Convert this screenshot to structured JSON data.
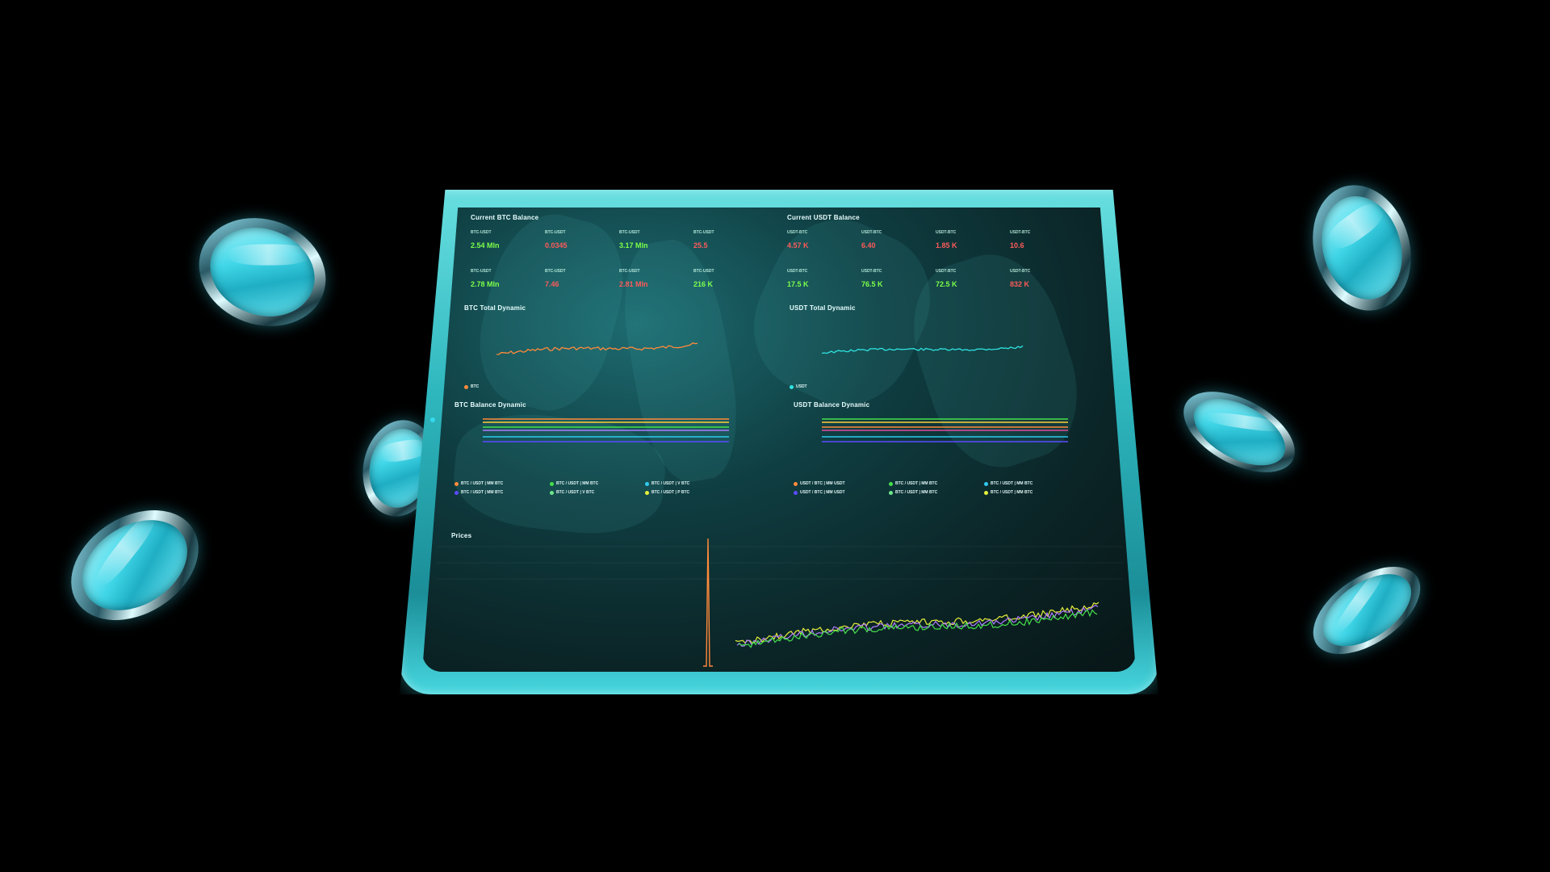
{
  "btc_balance": {
    "title": "Current BTC Balance",
    "cells": [
      {
        "label": "BTC-USDT",
        "value": "2.54 Mln",
        "tone": "pos"
      },
      {
        "label": "BTC-USDT",
        "value": "0.0345",
        "tone": "neg"
      },
      {
        "label": "BTC-USDT",
        "value": "3.17 Mln",
        "tone": "pos"
      },
      {
        "label": "BTC-USDT",
        "value": "25.5",
        "tone": "neg"
      },
      {
        "label": "BTC-USDT",
        "value": "2.78 Mln",
        "tone": "pos"
      },
      {
        "label": "BTC-USDT",
        "value": "7.46",
        "tone": "neg"
      },
      {
        "label": "BTC-USDT",
        "value": "2.81 Mln",
        "tone": "neg"
      },
      {
        "label": "BTC-USDT",
        "value": "216 K",
        "tone": "pos"
      }
    ]
  },
  "usdt_balance": {
    "title": "Current USDT Balance",
    "cells": [
      {
        "label": "USDT-BTC",
        "value": "4.57 K",
        "tone": "neg"
      },
      {
        "label": "USDT-BTC",
        "value": "6.40",
        "tone": "neg"
      },
      {
        "label": "USDT-BTC",
        "value": "1.85 K",
        "tone": "neg"
      },
      {
        "label": "USDT-BTC",
        "value": "10.6",
        "tone": "neg"
      },
      {
        "label": "USDT-BTC",
        "value": "17.5 K",
        "tone": "pos"
      },
      {
        "label": "USDT-BTC",
        "value": "76.5 K",
        "tone": "pos"
      },
      {
        "label": "USDT-BTC",
        "value": "72.5 K",
        "tone": "pos"
      },
      {
        "label": "USDT-BTC",
        "value": "832 K",
        "tone": "neg"
      }
    ]
  },
  "btc_total": {
    "title": "BTC Total Dynamic",
    "legend": "BTC",
    "color": "#ff8a3a"
  },
  "usdt_total": {
    "title": "USDT Total Dynamic",
    "legend": "USDT",
    "color": "#2fe3e0"
  },
  "btc_balance_dynamic": {
    "title": "BTC Balance Dynamic",
    "legend": [
      {
        "label": "BTC / USDT | MM BTC",
        "color": "#ff8a3a"
      },
      {
        "label": "BTC / USDT | MM BTC",
        "color": "#45e04a"
      },
      {
        "label": "BTC / USDT | V BTC",
        "color": "#2fc9f0"
      },
      {
        "label": "BTC / USDT | MM BTC",
        "color": "#5b4bff"
      },
      {
        "label": "BTC / USDT | V BTC",
        "color": "#6ee68a"
      },
      {
        "label": "BTC / USDT | P BTC",
        "color": "#e5f03a"
      }
    ],
    "lines": [
      "#ff8a3a",
      "#ffcf3a",
      "#45e04a",
      "#b07aff",
      "#2fc9f0",
      "#5b4bff"
    ]
  },
  "usdt_balance_dynamic": {
    "title": "USDT Balance Dynamic",
    "legend": [
      {
        "label": "USDT / BTC | MM USDT",
        "color": "#ff8a3a"
      },
      {
        "label": "BTC / USDT | MM BTC",
        "color": "#45e04a"
      },
      {
        "label": "BTC / USDT | MM BTC",
        "color": "#2fc9f0"
      },
      {
        "label": "USDT / BTC | MM USDT",
        "color": "#5b4bff"
      },
      {
        "label": "BTC / USDT | MM BTC",
        "color": "#6ee68a"
      },
      {
        "label": "BTC / USDT | MM BTC",
        "color": "#e5f03a"
      }
    ],
    "lines": [
      "#45e04a",
      "#ffcf3a",
      "#ff8a3a",
      "#e04aa0",
      "#2fc9f0",
      "#5b4bff"
    ]
  },
  "prices": {
    "title": "Prices"
  }
}
